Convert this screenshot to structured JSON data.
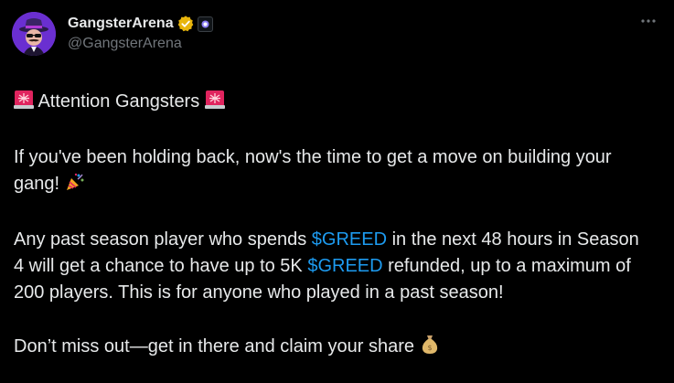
{
  "account": {
    "display_name": "GangsterArena",
    "handle": "@GangsterArena",
    "avatar_icon": "gangster-fedora-avatar",
    "verified_color": "#e8b50c",
    "avatar_bg": "#6a2fd1"
  },
  "more_icon": "more-dots-icon",
  "tweet": {
    "line1": "Attention Gangsters",
    "para2": "If you've been holding back, now's the time to get a move on building your gang!",
    "para3_a": "Any past season player who spends ",
    "cashtag1": "$GREED",
    "para3_b": " in the next 48 hours in Season 4 will get a chance to have up to 5K ",
    "cashtag2": "$GREED",
    "para3_c": " refunded, up to a maximum of 200 players. This is for anyone who played in a past season!",
    "para4": "Don’t miss out—get in there and claim your share",
    "cashtag_color": "#1d9bf0"
  }
}
